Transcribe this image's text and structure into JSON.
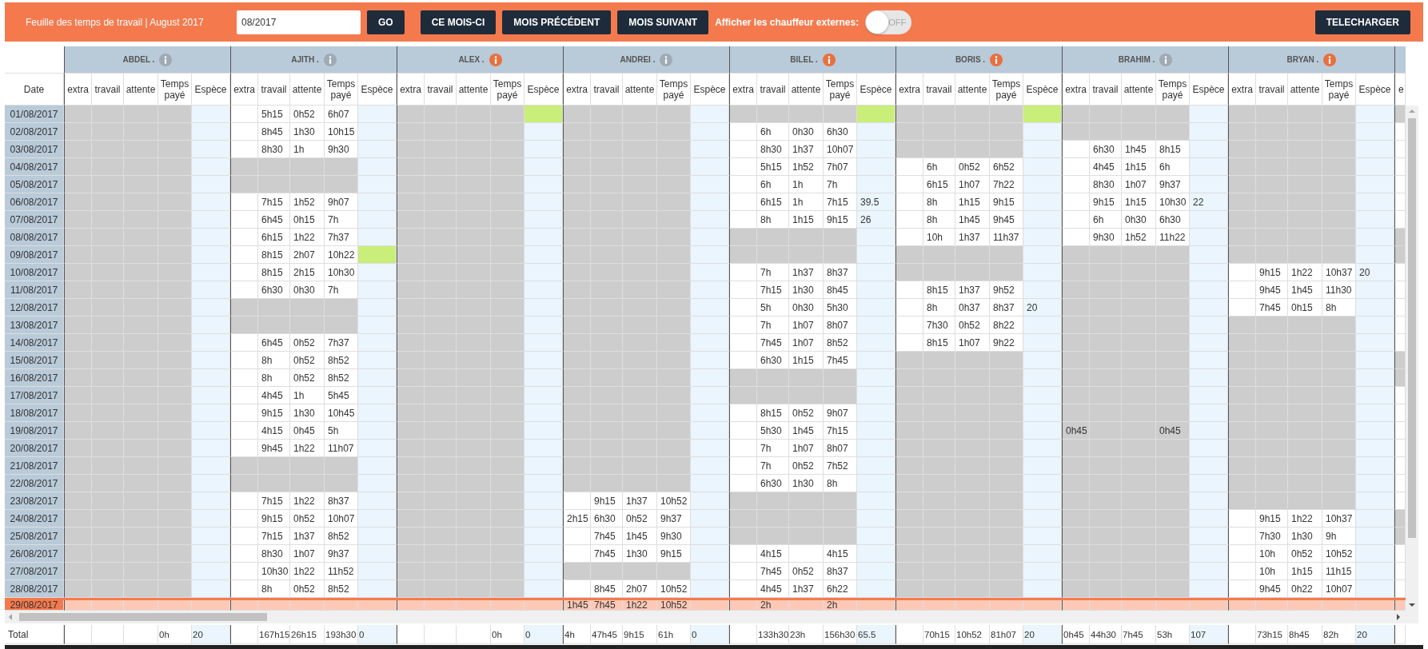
{
  "header": {
    "title": "Feuille des temps de travail | August 2017",
    "month_input": {
      "value": "08/2017"
    },
    "go_button": "GO",
    "nav_buttons": [
      "CE MOIS-CI",
      "MOIS PRÉCÉDENT",
      "MOIS SUIVANT"
    ],
    "externals_label": "Afficher les chauffeur externes:",
    "externals_toggle": {
      "on": false,
      "text": "OFF"
    },
    "download_button": "TELECHARGER"
  },
  "table": {
    "date_header": "Date",
    "total_label": "Total",
    "dates": [
      {
        "date": "01/08/2017",
        "current": false
      },
      {
        "date": "02/08/2017",
        "current": false
      },
      {
        "date": "03/08/2017",
        "current": false
      },
      {
        "date": "04/08/2017",
        "current": false
      },
      {
        "date": "05/08/2017",
        "current": false
      },
      {
        "date": "06/08/2017",
        "current": false
      },
      {
        "date": "07/08/2017",
        "current": false
      },
      {
        "date": "08/08/2017",
        "current": false
      },
      {
        "date": "09/08/2017",
        "current": false
      },
      {
        "date": "10/08/2017",
        "current": false
      },
      {
        "date": "11/08/2017",
        "current": false
      },
      {
        "date": "12/08/2017",
        "current": false
      },
      {
        "date": "13/08/2017",
        "current": false
      },
      {
        "date": "14/08/2017",
        "current": false
      },
      {
        "date": "15/08/2017",
        "current": false
      },
      {
        "date": "16/08/2017",
        "current": false
      },
      {
        "date": "17/08/2017",
        "current": false
      },
      {
        "date": "18/08/2017",
        "current": false
      },
      {
        "date": "19/08/2017",
        "current": false
      },
      {
        "date": "20/08/2017",
        "current": false
      },
      {
        "date": "21/08/2017",
        "current": false
      },
      {
        "date": "22/08/2017",
        "current": false
      },
      {
        "date": "23/08/2017",
        "current": false
      },
      {
        "date": "24/08/2017",
        "current": false
      },
      {
        "date": "25/08/2017",
        "current": false
      },
      {
        "date": "26/08/2017",
        "current": false
      },
      {
        "date": "27/08/2017",
        "current": false
      },
      {
        "date": "28/08/2017",
        "current": false
      },
      {
        "date": "29/08/2017",
        "current": true
      }
    ],
    "drivers": [
      {
        "name": "ABDEL .",
        "alert": false,
        "columns": [
          "extra",
          "travail",
          "attente",
          "Temps payé",
          "Espèce"
        ],
        "totals": {
          "temps": "0h",
          "espece": "20"
        },
        "days": [
          {
            "off": true,
            "flag": false
          },
          {
            "off": true,
            "flag": false
          },
          {
            "off": true,
            "flag": false
          },
          {
            "off": true,
            "flag": false
          },
          {
            "off": true,
            "flag": false
          },
          {
            "off": true,
            "flag": false
          },
          {
            "off": true,
            "flag": false
          },
          {
            "off": true,
            "flag": false
          },
          {
            "off": true,
            "flag": false
          },
          {
            "off": true,
            "flag": false
          },
          {
            "off": true,
            "flag": false
          },
          {
            "off": true,
            "flag": false
          },
          {
            "off": true,
            "flag": false
          },
          {
            "off": true,
            "flag": false
          },
          {
            "off": true,
            "flag": false
          },
          {
            "off": true,
            "flag": false
          },
          {
            "off": true,
            "flag": false
          },
          {
            "off": true,
            "flag": false
          },
          {
            "off": true,
            "flag": false
          },
          {
            "off": true,
            "flag": false
          },
          {
            "off": true,
            "flag": false
          },
          {
            "off": true,
            "flag": false
          },
          {
            "off": true,
            "flag": false
          },
          {
            "off": true,
            "flag": false
          },
          {
            "off": true,
            "flag": false
          },
          {
            "off": true,
            "flag": false
          },
          {
            "off": true,
            "flag": false
          },
          {
            "off": true,
            "flag": false
          },
          {
            "off": false,
            "flag": false
          }
        ]
      },
      {
        "name": "AJITH .",
        "alert": false,
        "columns": [
          "extra",
          "travail",
          "attente",
          "Temps payé",
          "Espèce"
        ],
        "totals": {
          "travail": "167h15",
          "attente": "26h15",
          "temps": "193h30",
          "espece": "0"
        },
        "days": [
          {
            "off": false,
            "flag": false,
            "travail": "5h15",
            "attente": "0h52",
            "temps": "6h07"
          },
          {
            "off": false,
            "flag": false,
            "travail": "8h45",
            "attente": "1h30",
            "temps": "10h15"
          },
          {
            "off": false,
            "flag": false,
            "travail": "8h30",
            "attente": "1h",
            "temps": "9h30"
          },
          {
            "off": true,
            "flag": false
          },
          {
            "off": true,
            "flag": false
          },
          {
            "off": false,
            "flag": false,
            "travail": "7h15",
            "attente": "1h52",
            "temps": "9h07"
          },
          {
            "off": false,
            "flag": false,
            "travail": "6h45",
            "attente": "0h15",
            "temps": "7h"
          },
          {
            "off": false,
            "flag": false,
            "travail": "6h15",
            "attente": "1h22",
            "temps": "7h37"
          },
          {
            "off": false,
            "flag": true,
            "travail": "8h15",
            "attente": "2h07",
            "temps": "10h22"
          },
          {
            "off": false,
            "flag": false,
            "travail": "8h15",
            "attente": "2h15",
            "temps": "10h30"
          },
          {
            "off": false,
            "flag": false,
            "travail": "6h30",
            "attente": "0h30",
            "temps": "7h"
          },
          {
            "off": true,
            "flag": false
          },
          {
            "off": true,
            "flag": false
          },
          {
            "off": false,
            "flag": false,
            "travail": "6h45",
            "attente": "0h52",
            "temps": "7h37"
          },
          {
            "off": false,
            "flag": false,
            "travail": "8h",
            "attente": "0h52",
            "temps": "8h52"
          },
          {
            "off": false,
            "flag": false,
            "travail": "8h",
            "attente": "0h52",
            "temps": "8h52"
          },
          {
            "off": false,
            "flag": false,
            "travail": "4h45",
            "attente": "1h",
            "temps": "5h45"
          },
          {
            "off": false,
            "flag": false,
            "travail": "9h15",
            "attente": "1h30",
            "temps": "10h45"
          },
          {
            "off": false,
            "flag": false,
            "travail": "4h15",
            "attente": "0h45",
            "temps": "5h"
          },
          {
            "off": false,
            "flag": false,
            "travail": "9h45",
            "attente": "1h22",
            "temps": "11h07"
          },
          {
            "off": true,
            "flag": false
          },
          {
            "off": true,
            "flag": false
          },
          {
            "off": false,
            "flag": false,
            "travail": "7h15",
            "attente": "1h22",
            "temps": "8h37"
          },
          {
            "off": false,
            "flag": false,
            "travail": "9h15",
            "attente": "0h52",
            "temps": "10h07"
          },
          {
            "off": false,
            "flag": false,
            "travail": "7h15",
            "attente": "1h37",
            "temps": "8h52"
          },
          {
            "off": false,
            "flag": false,
            "travail": "8h30",
            "attente": "1h07",
            "temps": "9h37"
          },
          {
            "off": false,
            "flag": false,
            "travail": "10h30",
            "attente": "1h22",
            "temps": "11h52"
          },
          {
            "off": false,
            "flag": false,
            "travail": "8h",
            "attente": "0h52",
            "temps": "8h52"
          },
          {
            "off": false,
            "flag": false
          }
        ]
      },
      {
        "name": "ALEX .",
        "alert": true,
        "columns": [
          "extra",
          "travail",
          "attente",
          "Temps payé",
          "Espèce"
        ],
        "totals": {
          "temps": "0h",
          "espece": "0"
        },
        "days": [
          {
            "off": true,
            "flag": true
          },
          {
            "off": true,
            "flag": false
          },
          {
            "off": true,
            "flag": false
          },
          {
            "off": true,
            "flag": false
          },
          {
            "off": true,
            "flag": false
          },
          {
            "off": true,
            "flag": false
          },
          {
            "off": true,
            "flag": false
          },
          {
            "off": true,
            "flag": false
          },
          {
            "off": true,
            "flag": false
          },
          {
            "off": true,
            "flag": false
          },
          {
            "off": true,
            "flag": false
          },
          {
            "off": true,
            "flag": false
          },
          {
            "off": true,
            "flag": false
          },
          {
            "off": true,
            "flag": false
          },
          {
            "off": true,
            "flag": false
          },
          {
            "off": true,
            "flag": false
          },
          {
            "off": true,
            "flag": false
          },
          {
            "off": true,
            "flag": false
          },
          {
            "off": true,
            "flag": false
          },
          {
            "off": true,
            "flag": false
          },
          {
            "off": true,
            "flag": false
          },
          {
            "off": true,
            "flag": false
          },
          {
            "off": true,
            "flag": false
          },
          {
            "off": true,
            "flag": false
          },
          {
            "off": true,
            "flag": false
          },
          {
            "off": true,
            "flag": false
          },
          {
            "off": true,
            "flag": false
          },
          {
            "off": true,
            "flag": false
          },
          {
            "off": false,
            "flag": false
          }
        ]
      },
      {
        "name": "ANDREI .",
        "alert": false,
        "columns": [
          "extra",
          "travail",
          "attente",
          "Temps payé",
          "Espèce"
        ],
        "totals": {
          "extra": "4h",
          "travail": "47h45",
          "attente": "9h15",
          "temps": "61h",
          "espece": "0"
        },
        "days": [
          {
            "off": true,
            "flag": false
          },
          {
            "off": true,
            "flag": false
          },
          {
            "off": true,
            "flag": false
          },
          {
            "off": true,
            "flag": false
          },
          {
            "off": true,
            "flag": false
          },
          {
            "off": true,
            "flag": false
          },
          {
            "off": true,
            "flag": false
          },
          {
            "off": true,
            "flag": false
          },
          {
            "off": true,
            "flag": false
          },
          {
            "off": true,
            "flag": false
          },
          {
            "off": true,
            "flag": false
          },
          {
            "off": true,
            "flag": false
          },
          {
            "off": true,
            "flag": false
          },
          {
            "off": true,
            "flag": false
          },
          {
            "off": true,
            "flag": false
          },
          {
            "off": true,
            "flag": false
          },
          {
            "off": true,
            "flag": false
          },
          {
            "off": true,
            "flag": false
          },
          {
            "off": true,
            "flag": false
          },
          {
            "off": true,
            "flag": false
          },
          {
            "off": true,
            "flag": false
          },
          {
            "off": true,
            "flag": false
          },
          {
            "off": false,
            "flag": false,
            "travail": "9h15",
            "attente": "1h37",
            "temps": "10h52"
          },
          {
            "off": false,
            "flag": false,
            "extra": "2h15",
            "travail": "6h30",
            "attente": "0h52",
            "temps": "9h37"
          },
          {
            "off": false,
            "flag": false,
            "travail": "7h45",
            "attente": "1h45",
            "temps": "9h30"
          },
          {
            "off": false,
            "flag": false,
            "travail": "7h45",
            "attente": "1h30",
            "temps": "9h15"
          },
          {
            "off": true,
            "flag": false
          },
          {
            "off": false,
            "flag": false,
            "travail": "8h45",
            "attente": "2h07",
            "temps": "10h52"
          },
          {
            "off": false,
            "flag": false,
            "extra": "1h45",
            "travail": "7h45",
            "attente": "1h22",
            "temps": "10h52"
          }
        ]
      },
      {
        "name": "BILEL .",
        "alert": true,
        "columns": [
          "extra",
          "travail",
          "attente",
          "Temps payé",
          "Espèce"
        ],
        "totals": {
          "travail": "133h30",
          "attente": "23h",
          "temps": "156h30",
          "espece": "65.5"
        },
        "days": [
          {
            "off": true,
            "flag": true
          },
          {
            "off": false,
            "flag": false,
            "travail": "6h",
            "attente": "0h30",
            "temps": "6h30"
          },
          {
            "off": false,
            "flag": false,
            "travail": "8h30",
            "attente": "1h37",
            "temps": "10h07"
          },
          {
            "off": false,
            "flag": false,
            "travail": "5h15",
            "attente": "1h52",
            "temps": "7h07"
          },
          {
            "off": false,
            "flag": false,
            "travail": "6h",
            "attente": "1h",
            "temps": "7h"
          },
          {
            "off": false,
            "flag": false,
            "travail": "6h15",
            "attente": "1h",
            "temps": "7h15",
            "espece": "39.5"
          },
          {
            "off": false,
            "flag": false,
            "travail": "8h",
            "attente": "1h15",
            "temps": "9h15",
            "espece": "26"
          },
          {
            "off": true,
            "flag": false
          },
          {
            "off": true,
            "flag": false
          },
          {
            "off": false,
            "flag": false,
            "travail": "7h",
            "attente": "1h37",
            "temps": "8h37"
          },
          {
            "off": false,
            "flag": false,
            "travail": "7h15",
            "attente": "1h30",
            "temps": "8h45"
          },
          {
            "off": false,
            "flag": false,
            "travail": "5h",
            "attente": "0h30",
            "temps": "5h30"
          },
          {
            "off": false,
            "flag": false,
            "travail": "7h",
            "attente": "1h07",
            "temps": "8h07"
          },
          {
            "off": false,
            "flag": false,
            "travail": "7h45",
            "attente": "1h07",
            "temps": "8h52"
          },
          {
            "off": false,
            "flag": false,
            "travail": "6h30",
            "attente": "1h15",
            "temps": "7h45"
          },
          {
            "off": true,
            "flag": false
          },
          {
            "off": true,
            "flag": false
          },
          {
            "off": false,
            "flag": false,
            "travail": "8h15",
            "attente": "0h52",
            "temps": "9h07"
          },
          {
            "off": false,
            "flag": false,
            "travail": "5h30",
            "attente": "1h45",
            "temps": "7h15"
          },
          {
            "off": false,
            "flag": false,
            "travail": "7h",
            "attente": "1h07",
            "temps": "8h07"
          },
          {
            "off": false,
            "flag": false,
            "travail": "7h",
            "attente": "0h52",
            "temps": "7h52"
          },
          {
            "off": false,
            "flag": false,
            "travail": "6h30",
            "attente": "1h30",
            "temps": "8h"
          },
          {
            "off": true,
            "flag": false
          },
          {
            "off": true,
            "flag": false
          },
          {
            "off": true,
            "flag": false
          },
          {
            "off": false,
            "flag": false,
            "travail": "4h15",
            "temps": "4h15"
          },
          {
            "off": false,
            "flag": false,
            "travail": "7h45",
            "attente": "0h52",
            "temps": "8h37"
          },
          {
            "off": false,
            "flag": false,
            "travail": "4h45",
            "attente": "1h37",
            "temps": "6h22"
          },
          {
            "off": false,
            "flag": false,
            "travail": "2h",
            "temps": "2h"
          }
        ]
      },
      {
        "name": "BORIS .",
        "alert": true,
        "columns": [
          "extra",
          "travail",
          "attente",
          "Temps payé",
          "Espèce"
        ],
        "totals": {
          "travail": "70h15",
          "attente": "10h52",
          "temps": "81h07",
          "espece": "20"
        },
        "days": [
          {
            "off": true,
            "flag": true
          },
          {
            "off": true,
            "flag": false
          },
          {
            "off": true,
            "flag": false
          },
          {
            "off": false,
            "flag": false,
            "travail": "6h",
            "attente": "0h52",
            "temps": "6h52"
          },
          {
            "off": false,
            "flag": false,
            "travail": "6h15",
            "attente": "1h07",
            "temps": "7h22"
          },
          {
            "off": false,
            "flag": false,
            "travail": "8h",
            "attente": "1h15",
            "temps": "9h15"
          },
          {
            "off": false,
            "flag": false,
            "travail": "8h",
            "attente": "1h45",
            "temps": "9h45"
          },
          {
            "off": false,
            "flag": false,
            "travail": "10h",
            "attente": "1h37",
            "temps": "11h37"
          },
          {
            "off": true,
            "flag": false
          },
          {
            "off": true,
            "flag": false
          },
          {
            "off": false,
            "flag": false,
            "travail": "8h15",
            "attente": "1h37",
            "temps": "9h52"
          },
          {
            "off": false,
            "flag": false,
            "travail": "8h",
            "attente": "0h37",
            "temps": "8h37",
            "espece": "20"
          },
          {
            "off": false,
            "flag": false,
            "travail": "7h30",
            "attente": "0h52",
            "temps": "8h22"
          },
          {
            "off": false,
            "flag": false,
            "travail": "8h15",
            "attente": "1h07",
            "temps": "9h22"
          },
          {
            "off": true,
            "flag": false
          },
          {
            "off": true,
            "flag": false
          },
          {
            "off": true,
            "flag": false
          },
          {
            "off": true,
            "flag": false
          },
          {
            "off": true,
            "flag": false
          },
          {
            "off": true,
            "flag": false
          },
          {
            "off": true,
            "flag": false
          },
          {
            "off": true,
            "flag": false
          },
          {
            "off": true,
            "flag": false
          },
          {
            "off": true,
            "flag": false
          },
          {
            "off": true,
            "flag": false
          },
          {
            "off": true,
            "flag": false
          },
          {
            "off": true,
            "flag": false
          },
          {
            "off": true,
            "flag": false
          },
          {
            "off": false,
            "flag": false
          }
        ]
      },
      {
        "name": "BRAHIM .",
        "alert": false,
        "columns": [
          "extra",
          "travail",
          "attente",
          "Temps payé",
          "Espèce"
        ],
        "totals": {
          "extra": "0h45",
          "travail": "44h30",
          "attente": "7h45",
          "temps": "53h",
          "espece": "107"
        },
        "days": [
          {
            "off": true,
            "flag": false
          },
          {
            "off": true,
            "flag": false
          },
          {
            "off": false,
            "flag": false,
            "travail": "6h30",
            "attente": "1h45",
            "temps": "8h15"
          },
          {
            "off": false,
            "flag": false,
            "travail": "4h45",
            "attente": "1h15",
            "temps": "6h"
          },
          {
            "off": false,
            "flag": false,
            "travail": "8h30",
            "attente": "1h07",
            "temps": "9h37"
          },
          {
            "off": false,
            "flag": false,
            "travail": "9h15",
            "attente": "1h15",
            "temps": "10h30",
            "espece": "22"
          },
          {
            "off": false,
            "flag": false,
            "travail": "6h",
            "attente": "0h30",
            "temps": "6h30"
          },
          {
            "off": false,
            "flag": false,
            "travail": "9h30",
            "attente": "1h52",
            "temps": "11h22"
          },
          {
            "off": true,
            "flag": false
          },
          {
            "off": true,
            "flag": false
          },
          {
            "off": true,
            "flag": false
          },
          {
            "off": true,
            "flag": false
          },
          {
            "off": true,
            "flag": false
          },
          {
            "off": true,
            "flag": false
          },
          {
            "off": true,
            "flag": false
          },
          {
            "off": true,
            "flag": false
          },
          {
            "off": true,
            "flag": false
          },
          {
            "off": true,
            "flag": false
          },
          {
            "off": true,
            "flag": false,
            "extra": "0h45",
            "temps": "0h45"
          },
          {
            "off": true,
            "flag": false
          },
          {
            "off": true,
            "flag": false
          },
          {
            "off": true,
            "flag": false
          },
          {
            "off": true,
            "flag": false
          },
          {
            "off": true,
            "flag": false
          },
          {
            "off": true,
            "flag": false
          },
          {
            "off": true,
            "flag": false
          },
          {
            "off": true,
            "flag": false
          },
          {
            "off": true,
            "flag": false
          },
          {
            "off": false,
            "flag": false
          }
        ]
      },
      {
        "name": "BRYAN .",
        "alert": true,
        "columns": [
          "extra",
          "travail",
          "attente",
          "Temps payé",
          "Espèce"
        ],
        "totals": {
          "travail": "73h15",
          "attente": "8h45",
          "temps": "82h",
          "espece": "20"
        },
        "days": [
          {
            "off": true,
            "flag": false
          },
          {
            "off": true,
            "flag": false
          },
          {
            "off": true,
            "flag": false
          },
          {
            "off": true,
            "flag": false
          },
          {
            "off": true,
            "flag": false
          },
          {
            "off": true,
            "flag": false
          },
          {
            "off": true,
            "flag": false
          },
          {
            "off": true,
            "flag": false
          },
          {
            "off": true,
            "flag": false
          },
          {
            "off": false,
            "flag": false,
            "travail": "9h15",
            "attente": "1h22",
            "temps": "10h37",
            "espece": "20"
          },
          {
            "off": false,
            "flag": false,
            "travail": "9h45",
            "attente": "1h45",
            "temps": "11h30"
          },
          {
            "off": false,
            "flag": false,
            "travail": "7h45",
            "attente": "0h15",
            "temps": "8h"
          },
          {
            "off": true,
            "flag": false
          },
          {
            "off": true,
            "flag": false
          },
          {
            "off": true,
            "flag": false
          },
          {
            "off": true,
            "flag": false
          },
          {
            "off": true,
            "flag": false
          },
          {
            "off": true,
            "flag": false
          },
          {
            "off": true,
            "flag": false
          },
          {
            "off": true,
            "flag": false
          },
          {
            "off": true,
            "flag": false
          },
          {
            "off": true,
            "flag": false
          },
          {
            "off": true,
            "flag": false
          },
          {
            "off": false,
            "flag": false,
            "travail": "9h15",
            "attente": "1h22",
            "temps": "10h37"
          },
          {
            "off": false,
            "flag": false,
            "travail": "7h30",
            "attente": "1h30",
            "temps": "9h"
          },
          {
            "off": false,
            "flag": false,
            "travail": "10h",
            "attente": "0h52",
            "temps": "10h52"
          },
          {
            "off": false,
            "flag": false,
            "travail": "10h",
            "attente": "1h15",
            "temps": "11h15"
          },
          {
            "off": false,
            "flag": false,
            "travail": "9h45",
            "attente": "0h22",
            "temps": "10h07"
          },
          {
            "off": false,
            "flag": false
          }
        ]
      }
    ],
    "partial_column": {
      "label": "e",
      "days": [
        {
          "off": true
        },
        {
          "off": false
        },
        {
          "off": false
        },
        {
          "off": false
        },
        {
          "off": false
        },
        {
          "off": false
        },
        {
          "off": false
        },
        {
          "off": true
        },
        {
          "off": true
        },
        {
          "off": false
        },
        {
          "off": false
        },
        {
          "off": false
        },
        {
          "off": false
        },
        {
          "off": false
        },
        {
          "off": true
        },
        {
          "off": true
        },
        {
          "off": false
        },
        {
          "off": false
        },
        {
          "off": false
        },
        {
          "off": false
        },
        {
          "off": false
        },
        {
          "off": false
        },
        {
          "off": false
        },
        {
          "off": true
        },
        {
          "off": true
        },
        {
          "off": false
        },
        {
          "off": false
        },
        {
          "off": false
        },
        {
          "off": false
        }
      ]
    }
  }
}
